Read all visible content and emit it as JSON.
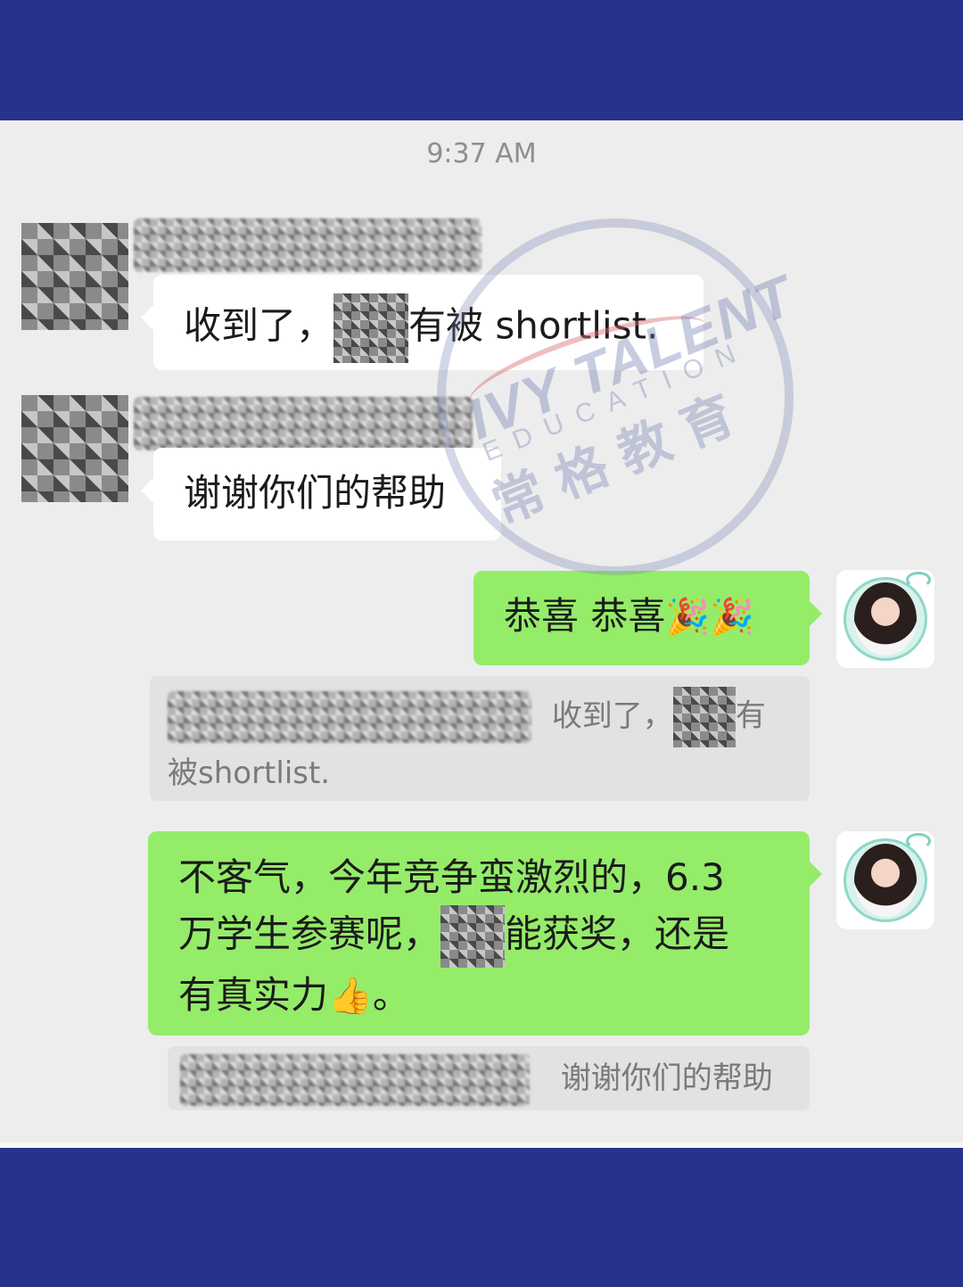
{
  "timestamp": "9:37 AM",
  "messages": {
    "m1": {
      "before": "收到了，",
      "after": "有被 shortlist."
    },
    "m2": {
      "text": "谢谢你们的帮助"
    },
    "m3": {
      "text": "恭喜 恭喜",
      "emoji": "🎉🎉"
    },
    "q1": {
      "before": "收到了，",
      "after": "有",
      "line2": "被shortlist."
    },
    "m4": {
      "line1": "不客气，今年竞争蛮激烈的，6.3",
      "line2_before": "万学生参赛呢，",
      "line2_after": "能获奖，还是",
      "line3": "有真实力",
      "line3_emoji": "👍",
      "line3_end": "。"
    },
    "q2": {
      "text": "谢谢你们的帮助"
    }
  },
  "watermark": {
    "brand": "IVY TALENT",
    "sub": "EDUCATION",
    "cn": "常格教育"
  },
  "colors": {
    "band": "#27338a",
    "chat_bg": "#ededed",
    "bubble_self": "#95ec69",
    "bubble_other": "#ffffff",
    "quote_bg": "#e2e2e2"
  }
}
